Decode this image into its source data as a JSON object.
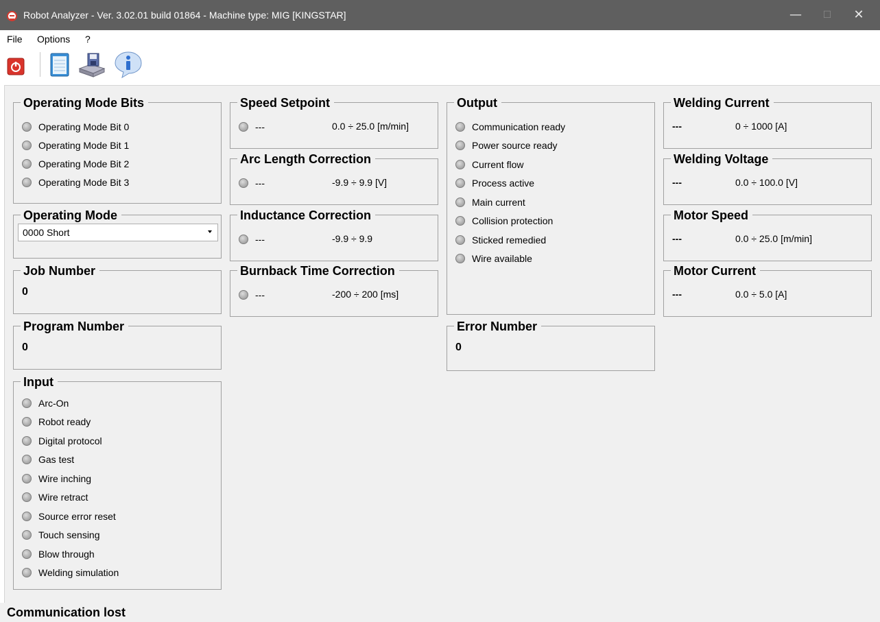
{
  "window": {
    "title": "Robot Analyzer - Ver. 3.02.01 build 01864 - Machine type: MIG [KINGSTAR]",
    "minimize": "—",
    "maximize": "☐",
    "close": "✕"
  },
  "menu": {
    "file": "File",
    "options": "Options",
    "help": "?"
  },
  "toolbar": {
    "icons": [
      "power-icon",
      "notepad-icon",
      "save-to-disk-icon",
      "info-icon"
    ],
    "colors": {
      "power": "#d9342b",
      "notepad": "#3a8fd6",
      "info": "#2f6fcf"
    }
  },
  "operating_mode_bits": {
    "title": "Operating Mode Bits",
    "items": [
      "Operating Mode Bit 0",
      "Operating Mode Bit 1",
      "Operating Mode Bit 2",
      "Operating Mode Bit 3"
    ]
  },
  "operating_mode": {
    "title": "Operating Mode",
    "selected": "0000 Short"
  },
  "job_number": {
    "title": "Job Number",
    "value": "0"
  },
  "program_number": {
    "title": "Program Number",
    "value": "0"
  },
  "input": {
    "title": "Input",
    "items": [
      "Arc-On",
      "Robot ready",
      "Digital protocol",
      "Gas test",
      "Wire inching",
      "Wire retract",
      "Source error reset",
      "Touch sensing",
      "Blow through",
      "Welding simulation"
    ]
  },
  "speed_setpoint": {
    "title": "Speed Setpoint",
    "value": "---",
    "range": "0.0 ÷ 25.0 [m/min]"
  },
  "arc_length_correction": {
    "title": "Arc Length Correction",
    "value": "---",
    "range": "-9.9 ÷ 9.9 [V]"
  },
  "inductance_correction": {
    "title": "Inductance Correction",
    "value": "---",
    "range": "-9.9 ÷ 9.9"
  },
  "burnback_time_correction": {
    "title": "Burnback Time Correction",
    "value": "---",
    "range": "-200 ÷ 200 [ms]"
  },
  "output": {
    "title": "Output",
    "items": [
      "Communication ready",
      "Power source ready",
      "Current flow",
      "Process active",
      "Main current",
      "Collision protection",
      "Sticked remedied",
      "Wire available"
    ]
  },
  "error_number": {
    "title": "Error Number",
    "value": "0"
  },
  "welding_current": {
    "title": "Welding Current",
    "value": "---",
    "range": "0 ÷ 1000 [A]"
  },
  "welding_voltage": {
    "title": "Welding Voltage",
    "value": "---",
    "range": "0.0 ÷ 100.0 [V]"
  },
  "motor_speed": {
    "title": "Motor Speed",
    "value": "---",
    "range": "0.0 ÷ 25.0 [m/min]"
  },
  "motor_current": {
    "title": "Motor Current",
    "value": "---",
    "range": "0.0 ÷ 5.0 [A]"
  },
  "status": {
    "text": "Communication lost"
  }
}
